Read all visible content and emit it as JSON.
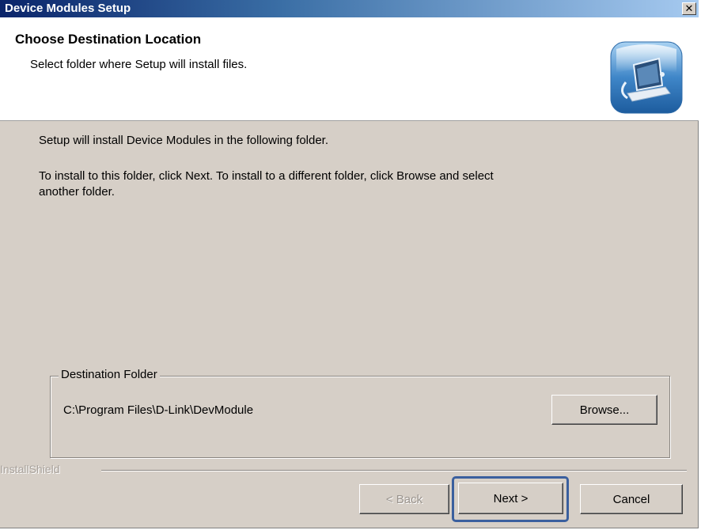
{
  "window": {
    "title": "Device Modules Setup",
    "close_label": "✕"
  },
  "header": {
    "title": "Choose Destination Location",
    "subtitle": "Select folder where Setup will install files.",
    "icon": "setup-computer-icon"
  },
  "body": {
    "line1": "Setup will install Device Modules in the following folder.",
    "line2a": "To install to this folder, click Next. To install to a different folder, click Browse and select",
    "line2b": "another folder."
  },
  "destination": {
    "legend": "Destination Folder",
    "path": "C:\\Program Files\\D-Link\\DevModule",
    "browse_label": "Browse..."
  },
  "footer": {
    "brand": "InstallShield",
    "back_label": "< Back",
    "next_label": "Next >",
    "cancel_label": "Cancel"
  },
  "colors": {
    "dialog_bg": "#d6cfc7",
    "title_start": "#0a246a",
    "title_end": "#a6caf0",
    "default_ring": "#3a5f9e"
  }
}
